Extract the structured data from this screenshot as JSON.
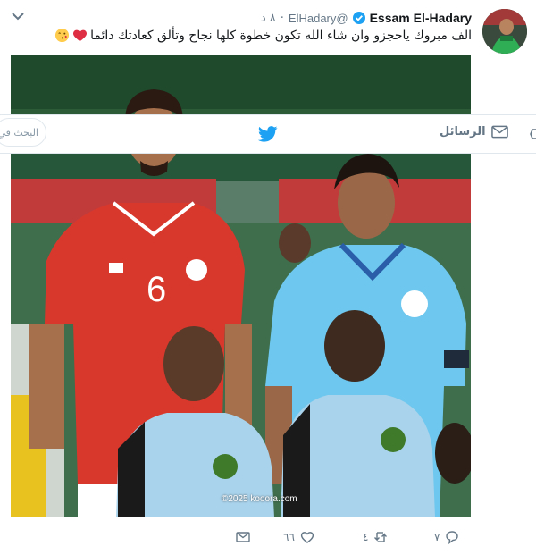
{
  "tweet": {
    "author_name": "Essam El-Hadary",
    "handle": "@ElHadary",
    "time": "٨ د",
    "separator": "·",
    "text": "الف مبروك ياحجزو وان شاء الله تكون خطوة كلها نجاح وتألق كعادتك دائما",
    "watermark": "©2025 kooora.com"
  },
  "navbar": {
    "messages_label": "الرسائل",
    "search_placeholder": "البحث في"
  },
  "actions": {
    "reply_count": "٧",
    "retweet_count": "٤",
    "like_count": "٦٦"
  },
  "colors": {
    "twitter_blue": "#1da1f2",
    "muted_gray": "#657786",
    "heart_red": "#e0245e"
  },
  "icons": [
    "chevron-down-icon",
    "verified-icon",
    "heart-emoji-icon",
    "kiss-emoji-icon",
    "twitter-bird-icon",
    "mail-icon",
    "reply-icon",
    "retweet-icon",
    "like-icon",
    "dm-icon"
  ]
}
